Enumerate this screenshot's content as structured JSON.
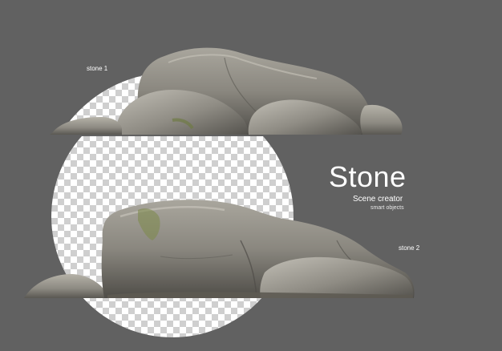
{
  "labels": {
    "stone_1": "stone 1",
    "stone_2": "stone 2"
  },
  "title": {
    "heading": "Stone",
    "subtitle": "Scene creator",
    "tagline": "smart objects"
  },
  "colors": {
    "background": "#616161",
    "text": "#ffffff",
    "checker_light": "#ffffff",
    "checker_dark": "#cfcfcf",
    "rock_base": "#8e8c85",
    "rock_shadow": "#4a4944",
    "rock_highlight": "#c9c6bd",
    "moss": "#7f8a4f"
  },
  "icons": {
    "transparency": "checkerboard-pattern",
    "objects": "stone-icon"
  }
}
